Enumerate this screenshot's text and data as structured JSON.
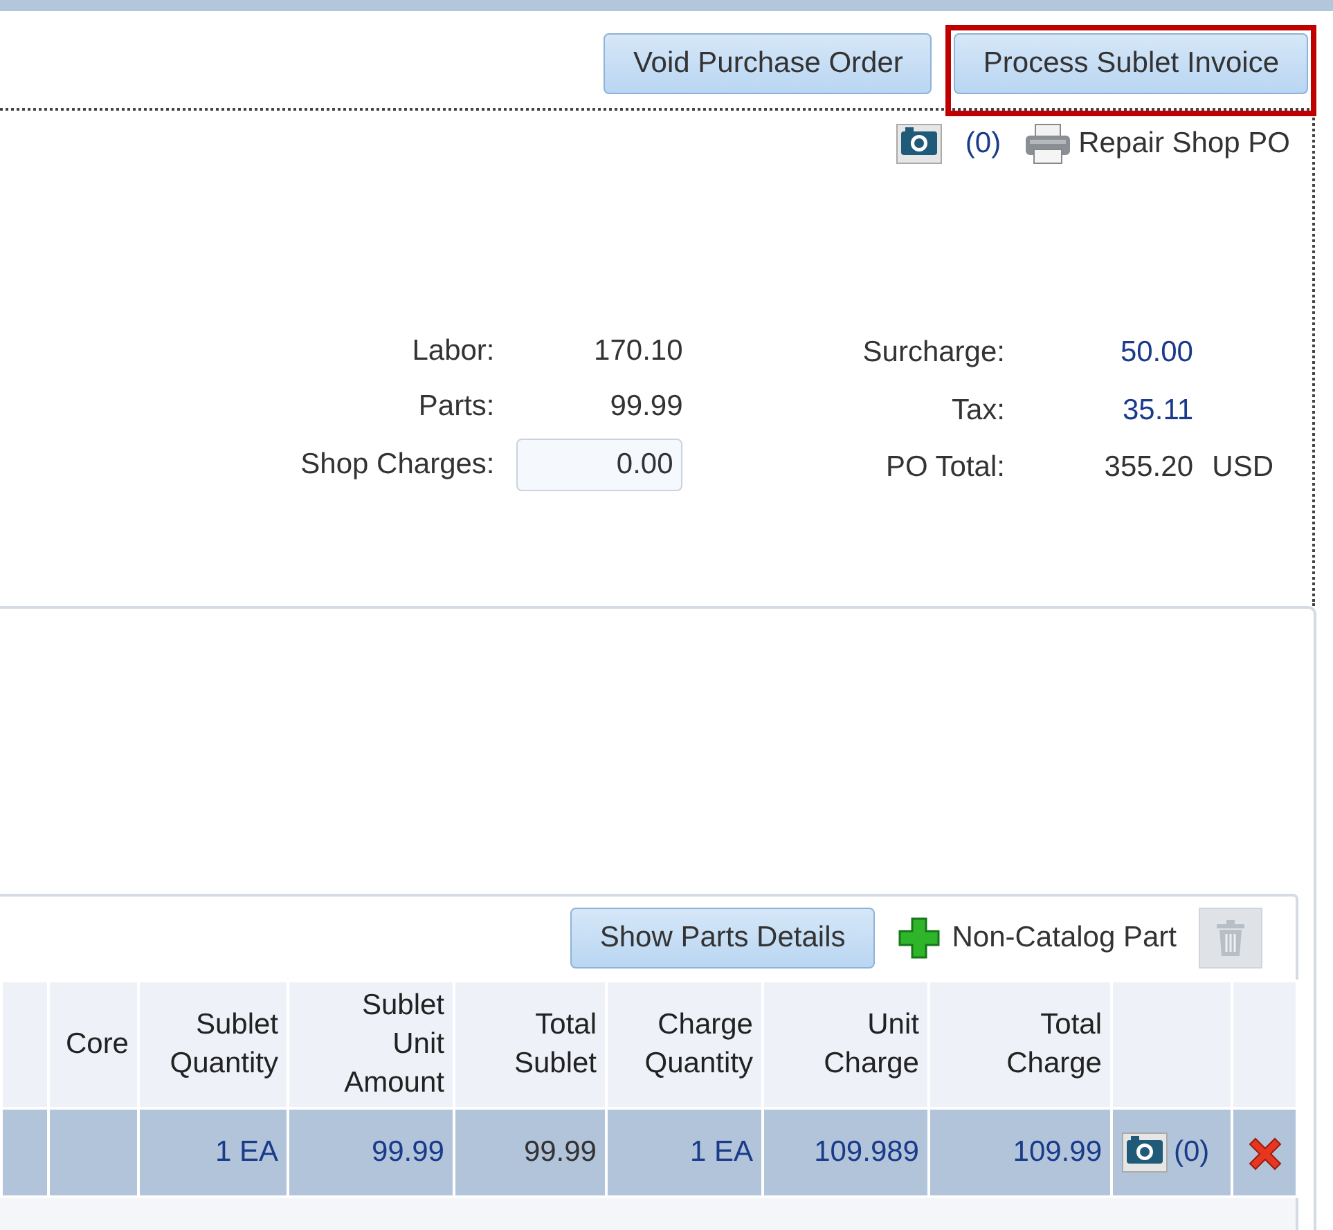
{
  "header_buttons": [
    {
      "label": "Void Purchase Order",
      "highlighted": false
    },
    {
      "label": "Process Sublet Invoice",
      "highlighted": true
    }
  ],
  "po_links": {
    "attachment_count": "(0)",
    "print_label": "Repair Shop PO"
  },
  "totals_left": [
    {
      "label": "Labor:",
      "value": "170.10",
      "kind": "text"
    },
    {
      "label": "Parts:",
      "value": "99.99",
      "kind": "text"
    },
    {
      "label": "Shop Charges:",
      "value": "0.00",
      "kind": "input"
    }
  ],
  "totals_right": [
    {
      "label": "Surcharge:",
      "value": "50.00",
      "link": true
    },
    {
      "label": "Tax:",
      "value": "35.11",
      "link": true
    },
    {
      "label": "PO Total:",
      "value": "355.20",
      "link": false,
      "currency": "USD"
    }
  ],
  "parts_toolbar": {
    "show_details": "Show Parts Details",
    "add_label": "Non-Catalog Part",
    "delete_disabled": true
  },
  "table": {
    "columns": [
      {
        "lines": [
          "Core"
        ]
      },
      {
        "lines": [
          "Sublet",
          "Quantity"
        ]
      },
      {
        "lines": [
          "Sublet",
          "Unit",
          "Amount"
        ]
      },
      {
        "lines": [
          "Total",
          "Sublet"
        ]
      },
      {
        "lines": [
          "Charge",
          "Quantity"
        ]
      },
      {
        "lines": [
          "Unit",
          "Charge"
        ]
      },
      {
        "lines": [
          "Total",
          "Charge"
        ]
      }
    ],
    "rows": [
      {
        "selected": true,
        "cells": [
          null,
          {
            "text": "1 EA",
            "link": true
          },
          {
            "text": "99.99",
            "link": true
          },
          {
            "text": "99.99",
            "link": false
          },
          {
            "text": "1 EA",
            "link": true
          },
          {
            "text": "109.989",
            "link": true
          },
          {
            "text": "109.99",
            "link": true
          }
        ],
        "attachments": "(0)",
        "deletable": true
      }
    ]
  }
}
